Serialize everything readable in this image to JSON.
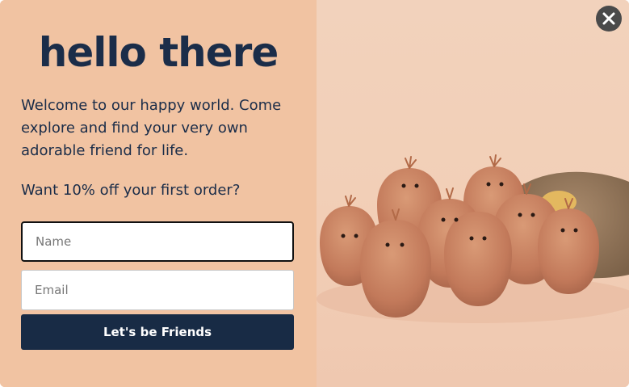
{
  "popup": {
    "title": "hello there",
    "welcome_text": "Welcome to our happy world. Come explore and find your very own adorable friend for life.",
    "offer_text": "Want 10% off your first order?",
    "name_placeholder": "Name",
    "email_placeholder": "Email",
    "submit_label": "Let's be Friends",
    "close_icon": "close-icon"
  },
  "colors": {
    "background": "#f1c3a2",
    "text": "#1b2d49",
    "button": "#182b45"
  }
}
